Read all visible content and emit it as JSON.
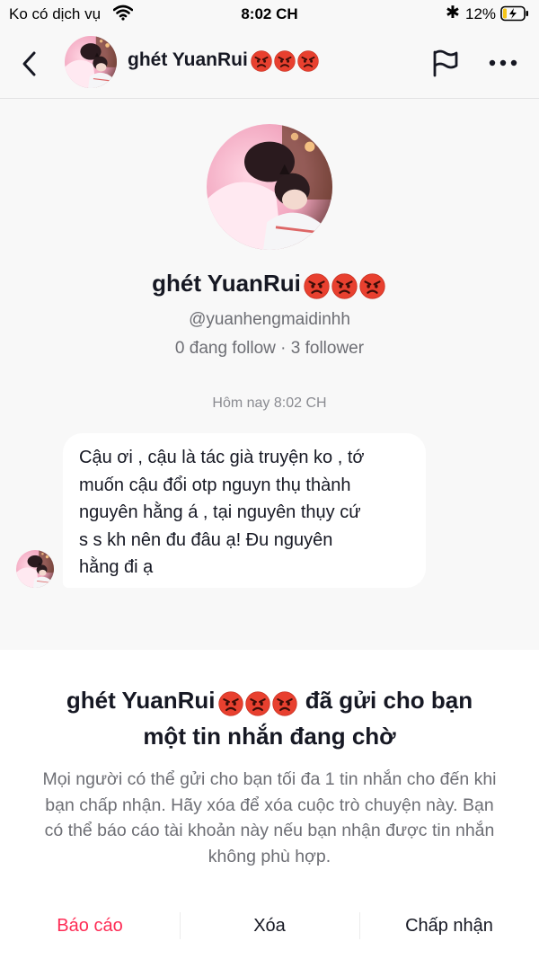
{
  "status_bar": {
    "carrier": "Ko có dịch vụ",
    "time": "8:02 CH",
    "bluetooth": "✱",
    "battery_percent": "12%"
  },
  "header": {
    "title": "ghét YuanRui",
    "title_emojis": [
      "angry-face",
      "angry-face",
      "angry-face"
    ],
    "icons": [
      "back-chevron-icon",
      "flag-icon",
      "more-dots-icon"
    ]
  },
  "profile": {
    "name": "ghét YuanRui",
    "handle": "@yuanhengmaidinhh",
    "stats": "0 đang follow · 3 follower"
  },
  "conversation": {
    "timestamp": "Hôm nay 8:02 CH",
    "messages": [
      {
        "lines": [
          "Cậu ơi , cậu là tác già truyện ko , tớ",
          "muốn cậu đổi otp nguyn thụ thành",
          "nguyên hằng á , tại nguyên thụy cứ",
          "s s kh nên đu đâu ạ! Đu nguyên",
          "hằng đi ạ"
        ]
      }
    ]
  },
  "sheet": {
    "title_name": "ghét YuanRui",
    "title_line1_suffix": "đã gửi cho bạn",
    "title_line2": "một tin nhắn đang chờ",
    "body": "Mọi người có thể gửi cho bạn tối đa 1 tin nhắn cho đến khi bạn chấp nhận. Hãy xóa để xóa cuộc trò chuyện này. Bạn có thể báo cáo tài khoản này nếu bạn nhận được tin nhắn không phù hợp.",
    "actions": {
      "report": "Báo cáo",
      "delete": "Xóa",
      "accept": "Chấp nhận"
    }
  },
  "colors": {
    "accent_red": "#fe2c55",
    "text_primary": "#161823",
    "text_secondary": "#6d6e74",
    "emoji_red": "#e8402f",
    "background": "#f8f8f8"
  }
}
